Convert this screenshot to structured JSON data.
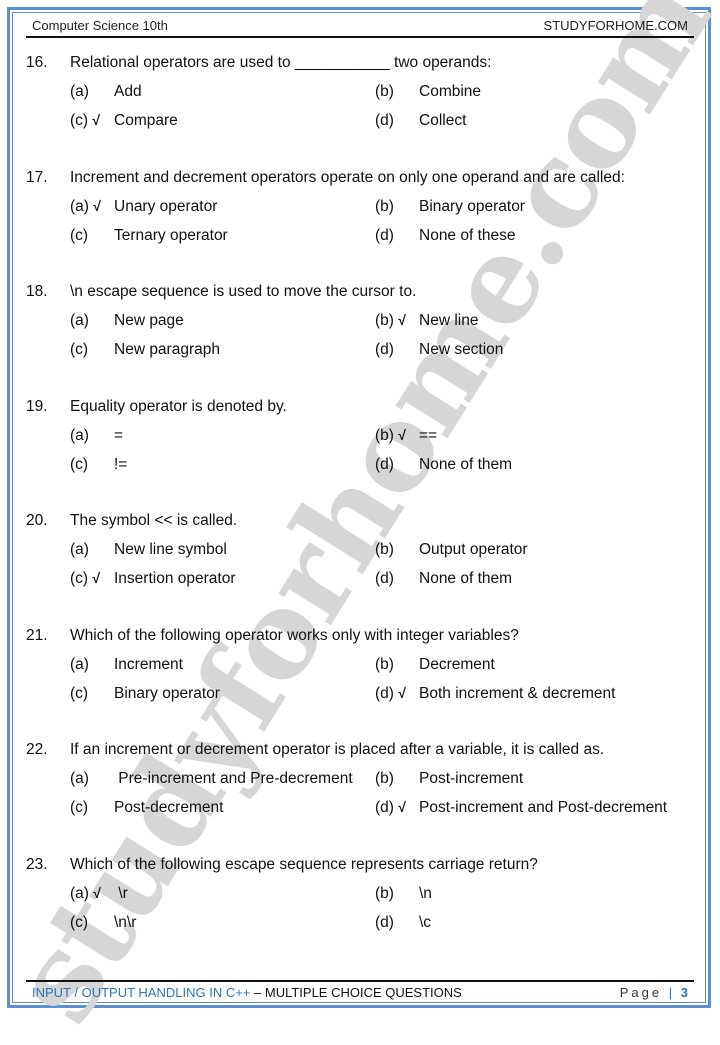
{
  "header": {
    "left": "Computer Science 10th",
    "right": "STUDYFORHOME.COM"
  },
  "watermark": "studyforhome.com",
  "questions": [
    {
      "number": "16.",
      "stem": "Relational operators are used to ___________ two operands:",
      "options": [
        {
          "label": "(a)",
          "text": "Add",
          "correct": ""
        },
        {
          "label": "(b)",
          "text": "Combine",
          "correct": ""
        },
        {
          "label": "(c)",
          "text": "Compare",
          "correct": "√"
        },
        {
          "label": "(d)",
          "text": "Collect",
          "correct": ""
        }
      ]
    },
    {
      "number": "17.",
      "stem": "Increment and decrement operators operate on only one operand and are called:",
      "options": [
        {
          "label": "(a)",
          "text": "Unary operator",
          "correct": "√"
        },
        {
          "label": "(b)",
          "text": "Binary operator",
          "correct": ""
        },
        {
          "label": "(c)",
          "text": "Ternary operator",
          "correct": ""
        },
        {
          "label": "(d)",
          "text": "None of these",
          "correct": ""
        }
      ]
    },
    {
      "number": "18.",
      "stem": "\\n escape sequence is used to move the cursor to.",
      "options": [
        {
          "label": "(a)",
          "text": "New page",
          "correct": ""
        },
        {
          "label": "(b)",
          "text": "New line",
          "correct": "√"
        },
        {
          "label": "(c)",
          "text": "New paragraph",
          "correct": ""
        },
        {
          "label": "(d)",
          "text": "New section",
          "correct": ""
        }
      ]
    },
    {
      "number": "19.",
      "stem": "Equality operator is denoted by.",
      "options": [
        {
          "label": "(a)",
          "text": "=",
          "correct": ""
        },
        {
          "label": "(b)",
          "text": "==",
          "correct": "√"
        },
        {
          "label": "(c)",
          "text": "!=",
          "correct": ""
        },
        {
          "label": "(d)",
          "text": "None of them",
          "correct": ""
        }
      ]
    },
    {
      "number": "20.",
      "stem": "The symbol << is called.",
      "options": [
        {
          "label": "(a)",
          "text": "New line symbol",
          "correct": ""
        },
        {
          "label": "(b)",
          "text": "Output operator",
          "correct": ""
        },
        {
          "label": "(c)",
          "text": "Insertion operator",
          "correct": "√"
        },
        {
          "label": "(d)",
          "text": "None of them",
          "correct": ""
        }
      ]
    },
    {
      "number": "21.",
      "stem": "Which of the following operator works only with integer variables?",
      "options": [
        {
          "label": "(a)",
          "text": "Increment",
          "correct": ""
        },
        {
          "label": "(b)",
          "text": "Decrement",
          "correct": ""
        },
        {
          "label": "(c)",
          "text": "Binary operator",
          "correct": ""
        },
        {
          "label": "(d)",
          "text": "Both increment & decrement",
          "correct": "√"
        }
      ]
    },
    {
      "number": "22.",
      "stem": "If an increment or decrement operator is placed after a variable, it is called as.",
      "options": [
        {
          "label": "(a)",
          "text": " Pre-increment and Pre-decrement",
          "correct": ""
        },
        {
          "label": "(b)",
          "text": "Post-increment",
          "correct": ""
        },
        {
          "label": "(c)",
          "text": "Post-decrement",
          "correct": ""
        },
        {
          "label": "(d)",
          "text": "Post-increment and Post-decrement",
          "correct": "√"
        }
      ]
    },
    {
      "number": "23.",
      "stem": "Which of the following escape sequence represents carriage return?",
      "options": [
        {
          "label": "(a)",
          "text": " \\r",
          "correct": "√"
        },
        {
          "label": "(b)",
          "text": "\\n",
          "correct": ""
        },
        {
          "label": "(c)",
          "text": "\\n\\r",
          "correct": ""
        },
        {
          "label": "(d)",
          "text": "\\c",
          "correct": ""
        }
      ]
    }
  ],
  "footer": {
    "topic": "INPUT / OUTPUT HANDLING IN C++",
    "dash": " – ",
    "section": "MULTIPLE CHOICE QUESTIONS",
    "page_word": "Page",
    "separator": "|",
    "page_number": "3"
  }
}
